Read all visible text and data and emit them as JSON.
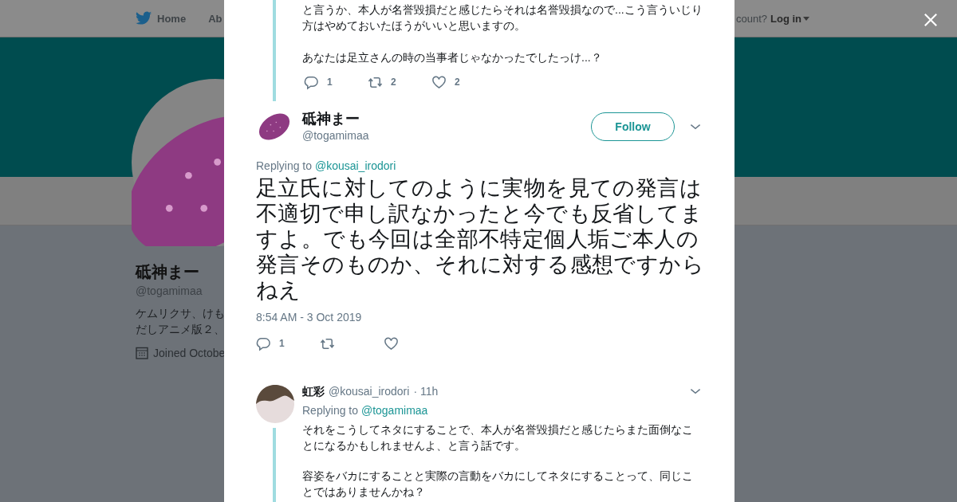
{
  "background_page": {
    "nav": {
      "home": "Home",
      "about": "Ab",
      "account_prompt": "count?",
      "login": "Log in"
    },
    "profile": {
      "name": "砥神まー",
      "handle": "@togamimaa",
      "bio_lines": [
        "ケムリクサ、けも",
        "だしアニメ版２、"
      ],
      "joined": "Joined Octobe"
    }
  },
  "conversation": {
    "previous_tweet": {
      "paragraphs": [
        "と言うか、本人が名誉毀損だと感じたらそれは名誉毀損なので...こう言ういじり方はやめておいたほうがいいと思いますの。",
        "あなたは足立さんの時の当事者じゃなかったでしたっけ...？"
      ],
      "actions": {
        "replies": "1",
        "retweets": "2",
        "likes": "2"
      }
    },
    "main_tweet": {
      "name": "砥神まー",
      "handle": "@togamimaa",
      "follow": "Follow",
      "replying_label": "Replying to",
      "replying_to": "@kousai_irodori",
      "text": "足立氏に対してのように実物を見ての発言は不適切で申し訳なかったと今でも反省してますよ。でも今回は全部不特定個人垢ご本人の発言そのものか、それに対する感想ですからねえ",
      "time": "8:54 AM - 3 Oct 2019",
      "actions": {
        "replies": "1"
      }
    },
    "reply_tweet": {
      "name": "虹彩",
      "handle": "@kousai_irodori",
      "age": "· 11h",
      "replying_label": "Replying to",
      "replying_to": "@togamimaa",
      "paragraphs": [
        "それをこうしてネタにすることで、本人が名誉毀損だと感じたらまた面倒なことになるかもしれませんよ、と言う話です。",
        "容姿をバカにすることと実際の言動をバカにしてネタにすることって、同じことではありませんかね？"
      ]
    }
  }
}
